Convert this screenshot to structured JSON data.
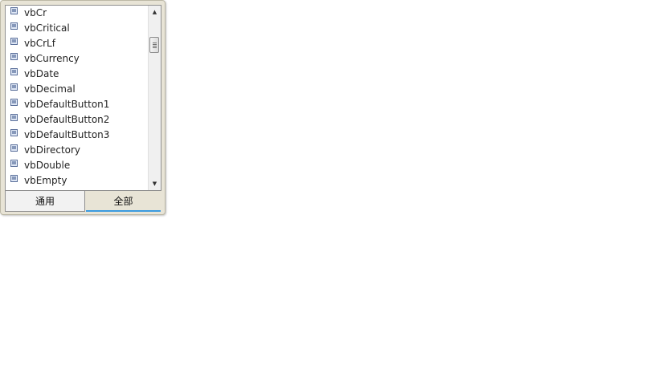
{
  "list": {
    "items": [
      {
        "label": "vbCr",
        "icon": "constant-icon"
      },
      {
        "label": "vbCritical",
        "icon": "constant-icon"
      },
      {
        "label": "vbCrLf",
        "icon": "constant-icon"
      },
      {
        "label": "vbCurrency",
        "icon": "constant-icon"
      },
      {
        "label": "vbDate",
        "icon": "constant-icon"
      },
      {
        "label": "vbDecimal",
        "icon": "constant-icon"
      },
      {
        "label": "vbDefaultButton1",
        "icon": "constant-icon"
      },
      {
        "label": "vbDefaultButton2",
        "icon": "constant-icon"
      },
      {
        "label": "vbDefaultButton3",
        "icon": "constant-icon"
      },
      {
        "label": "vbDirectory",
        "icon": "constant-icon"
      },
      {
        "label": "vbDouble",
        "icon": "constant-icon"
      },
      {
        "label": "vbEmpty",
        "icon": "constant-icon"
      }
    ]
  },
  "scrollbar": {
    "up_arrow": "▲",
    "down_arrow": "▼"
  },
  "tabs": {
    "common_label": "通用",
    "all_label": "全部",
    "active": "all"
  },
  "colors": {
    "active_tab_underline": "#3a9ae0",
    "icon_fill": "#9fb4d8"
  }
}
